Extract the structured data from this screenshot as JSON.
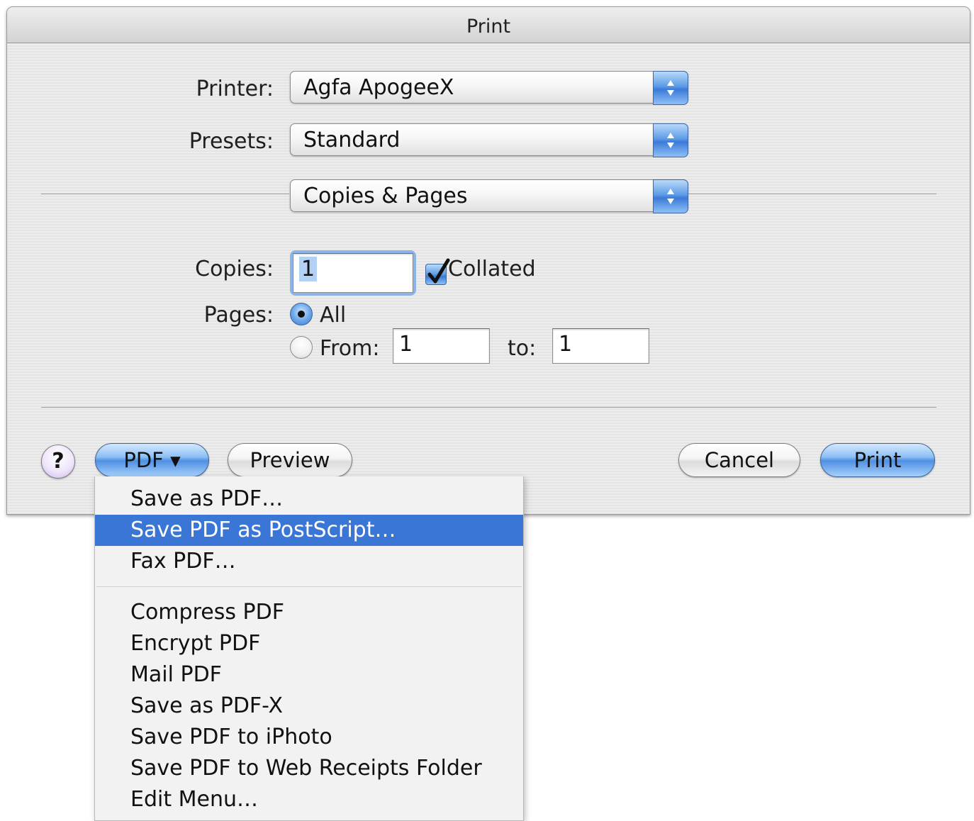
{
  "window": {
    "title": "Print"
  },
  "printer": {
    "label": "Printer:",
    "value": "Agfa ApogeeX"
  },
  "presets": {
    "label": "Presets:",
    "value": "Standard"
  },
  "panel": {
    "value": "Copies & Pages"
  },
  "copies": {
    "label": "Copies:",
    "value": "1",
    "collated_label": "Collated",
    "collated_checked": true
  },
  "pages": {
    "label": "Pages:",
    "all_label": "All",
    "from_label": "From:",
    "from_value": "1",
    "to_label": "to:",
    "to_value": "1",
    "selected": "all"
  },
  "buttons": {
    "help": "?",
    "pdf": "PDF ▾",
    "preview": "Preview",
    "cancel": "Cancel",
    "print": "Print"
  },
  "pdf_menu": {
    "items": [
      {
        "label": "Save as PDF…"
      },
      {
        "label": "Save PDF as PostScript…",
        "highlighted": true
      },
      {
        "label": "Fax PDF…"
      },
      {
        "label": "Compress PDF"
      },
      {
        "label": "Encrypt PDF"
      },
      {
        "label": "Mail PDF"
      },
      {
        "label": "Save as PDF-X"
      },
      {
        "label": "Save PDF to iPhoto"
      },
      {
        "label": "Save PDF to Web Receipts Folder"
      },
      {
        "label": "Edit Menu…"
      }
    ]
  },
  "colors": {
    "aqua_blue": "#3b7ad8",
    "menu_highlight": "#3a76d6",
    "dialog_bg": "#ececec"
  },
  "icons": [
    "popup-arrows-icon",
    "checkmark-icon",
    "help-icon",
    "triangle-down-icon"
  ]
}
